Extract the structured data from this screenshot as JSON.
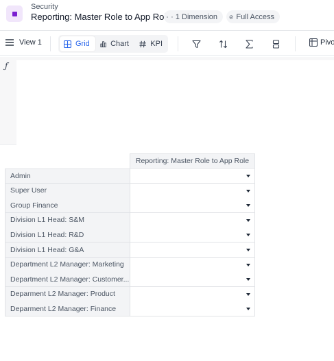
{
  "header": {
    "breadcrumb": "Security",
    "title": "Reporting: Master Role to App Role",
    "dimension_chip": "· 1 Dimension",
    "access_chip": "Full Access",
    "accent": "#7a1fd0"
  },
  "toolbar": {
    "view_label": "View 1",
    "tabs": [
      {
        "label": "Grid",
        "icon": "grid-icon",
        "active": true
      },
      {
        "label": "Chart",
        "icon": "bar-chart-icon",
        "active": false
      },
      {
        "label": "KPI",
        "icon": "hash-icon",
        "active": false
      }
    ],
    "tools": [
      "filter-icon",
      "sort-icon",
      "sum-icon",
      "rows-icon"
    ],
    "pivot_label": "Pivo"
  },
  "formula": {
    "symbol": "ƒ",
    "value": ""
  },
  "grid": {
    "column_header": "Reporting: Master Role to App Role",
    "rows": [
      {
        "label": "Admin",
        "value": ""
      },
      {
        "label": "Super User",
        "value": ""
      },
      {
        "label": "Group Finance",
        "value": ""
      },
      {
        "label": "Division L1 Head: S&M",
        "value": ""
      },
      {
        "label": "Division L1 Head: R&D",
        "value": ""
      },
      {
        "label": "Division L1 Head: G&A",
        "value": ""
      },
      {
        "label": "Department L2 Manager: Marketing",
        "value": ""
      },
      {
        "label": "Department L2 Manager: Customer...",
        "value": ""
      },
      {
        "label": "Deparment L2 Manager: Product",
        "value": ""
      },
      {
        "label": "Deparment L2 Manager: Finance",
        "value": ""
      }
    ]
  }
}
